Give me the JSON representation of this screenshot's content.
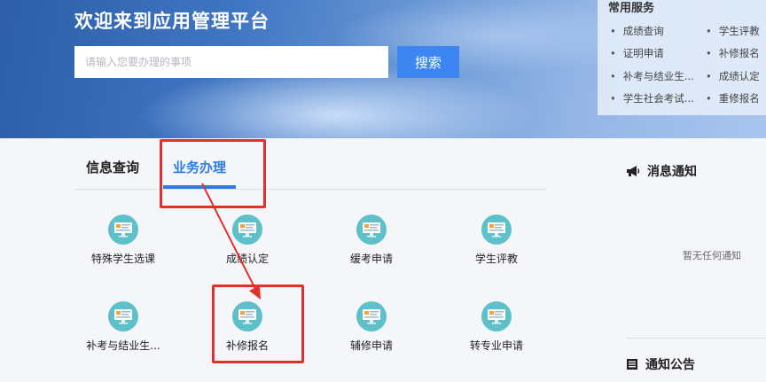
{
  "hero": {
    "title": "欢迎来到应用管理平台",
    "search_placeholder": "请输入您要办理的事项",
    "search_button": "搜索"
  },
  "services": {
    "title": "常用服务",
    "items": [
      "成绩查询",
      "学生评教",
      "证明申请",
      "补修报名",
      "补考与结业生...",
      "成绩认定",
      "学生社会考试...",
      "重修报名"
    ]
  },
  "tabs": [
    "信息查询",
    "业务办理"
  ],
  "active_tab": 1,
  "tiles": [
    "特殊学生选课",
    "成绩认定",
    "缓考申请",
    "学生评教",
    "补考与结业生...",
    "补修报名",
    "辅修申请",
    "转专业申请"
  ],
  "notices": {
    "message_title": "消息通知",
    "empty_text": "暂无任何通知",
    "announcement_title": "通知公告"
  },
  "colors": {
    "accent": "#3d86f2",
    "icon_bg": "#5ec0c8",
    "highlight": "#e0322b"
  }
}
